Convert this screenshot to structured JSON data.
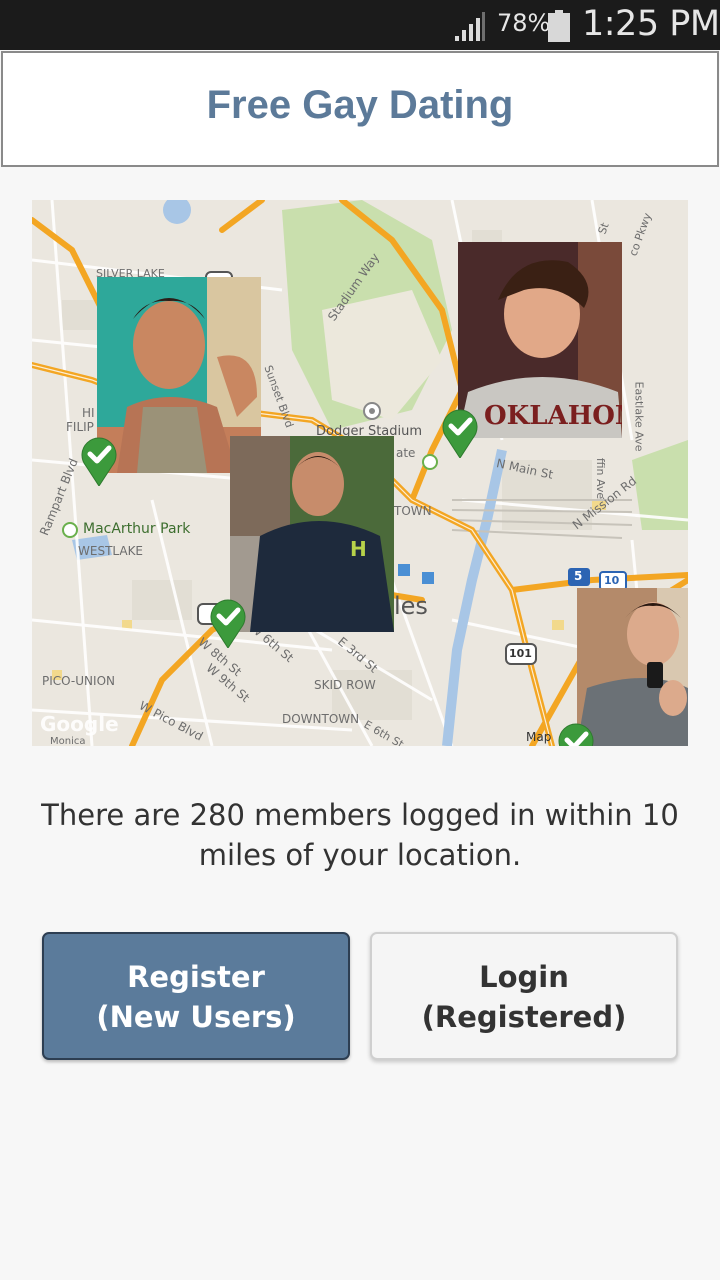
{
  "status_bar": {
    "battery_percent": "78%",
    "time": "1:25 PM"
  },
  "header": {
    "title": "Free Gay Dating"
  },
  "map": {
    "labels": {
      "silver_lake": "SILVER LAKE",
      "stadium_way": "Stadium Way",
      "dodger_stadium": "Dodger Stadium",
      "state_park": "State Park",
      "n_main_st": "N Main St",
      "n_mission_rd": "N Mission Rd",
      "eastlake_ave": "Eastlake Ave",
      "macarthur_park": "MacArthur Park",
      "westlake": "WESTLAKE",
      "pico_union": "PICO-UNION",
      "skid_row": "SKID ROW",
      "downtown": "DOWNTOWN",
      "e_3rd_st": "E 3rd St",
      "w_8th_st": "W 8th St",
      "w_9th_st": "W 9th St",
      "w_6th_st": "W 6th St",
      "w_pico_blvd": "W Pico Blvd",
      "e_6th_st": "E 6th St",
      "rampart_blvd": "Rampart Blvd",
      "sunset_blvd": "Sunset Blvd",
      "los_angeles_partial": "les",
      "town_partial": "TOWN",
      "fili_partial": "FILIP",
      "hi_partial": "HI",
      "griffin_partial": "ffin Ave",
      "pkwy_partial": "co Pkwy",
      "st_partial": "St",
      "hwy_5": "5",
      "hwy_10": "10",
      "hwy_101": "101",
      "google": "Google",
      "monica_partial": "Monica",
      "map_tag": "Map",
      "ate_partial": "ate"
    }
  },
  "info_text": "There are 280 members logged in within 10 miles of your location.",
  "buttons": {
    "register_line1": "Register",
    "register_line2": "(New Users)",
    "login_line1": "Login",
    "login_line2": "(Registered)"
  },
  "colors": {
    "accent": "#5b7b9b",
    "title": "#5c7a99",
    "pin_green": "#3c9a3c"
  },
  "icons": {
    "signal": "signal-icon",
    "battery": "battery-icon",
    "pin": "check-pin-icon"
  }
}
